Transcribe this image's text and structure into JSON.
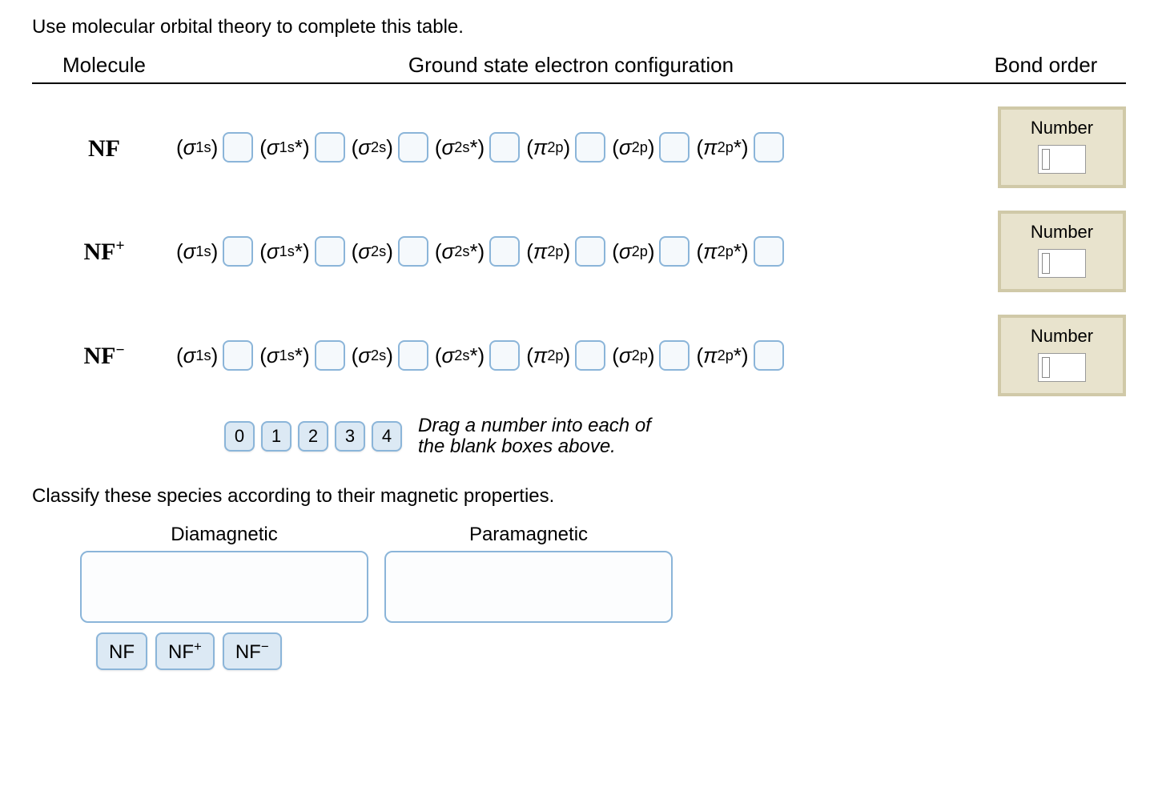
{
  "instruction1": "Use molecular orbital theory to complete this table.",
  "headers": {
    "molecule": "Molecule",
    "config": "Ground state electron configuration",
    "bond": "Bond order"
  },
  "rows": [
    {
      "molecule_html": "NF",
      "molecule_sup": ""
    },
    {
      "molecule_html": "NF",
      "molecule_sup": "+"
    },
    {
      "molecule_html": "NF",
      "molecule_sup": "−"
    }
  ],
  "orbitals": [
    "σ1s",
    "σ1s*",
    "σ2s",
    "σ2s*",
    "π2p",
    "σ2p",
    "π2p*"
  ],
  "bond_label": "Number",
  "number_bank": [
    "0",
    "1",
    "2",
    "3",
    "4"
  ],
  "bank_hint_l1": "Drag a number into each of",
  "bank_hint_l2": "the blank boxes above.",
  "instruction2": "Classify these species according to their magnetic properties.",
  "classify": {
    "dia": "Diamagnetic",
    "para": "Paramagnetic"
  },
  "species_bank": [
    {
      "label": "NF",
      "sup": ""
    },
    {
      "label": "NF",
      "sup": "+"
    },
    {
      "label": "NF",
      "sup": "−"
    }
  ]
}
